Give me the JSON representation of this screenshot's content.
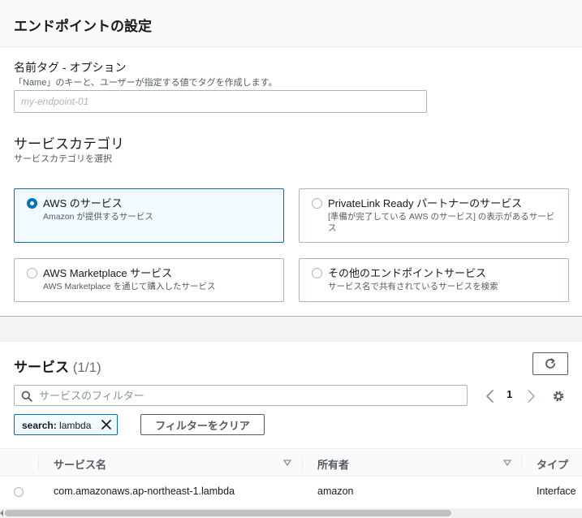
{
  "endpoint_settings": {
    "title": "エンドポイントの設定",
    "name_tag": {
      "label": "名前タグ - オプション",
      "description": "「Name」のキーと、ユーザーが指定する値でタグを作成します。",
      "placeholder": "my-endpoint-01",
      "value": ""
    },
    "service_category": {
      "title": "サービスカテゴリ",
      "description": "サービスカテゴリを選択",
      "selected": "aws",
      "options": [
        {
          "id": "aws",
          "title": "AWS のサービス",
          "description": "Amazon が提供するサービス"
        },
        {
          "id": "privatelink",
          "title": "PrivateLink Ready パートナーのサービス",
          "description": "[準備が完了している AWS のサービス] の表示があるサービス"
        },
        {
          "id": "marketplace",
          "title": "AWS Marketplace サービス",
          "description": "AWS Marketplace を通じて購入したサービス"
        },
        {
          "id": "other",
          "title": "その他のエンドポイントサービス",
          "description": "サービス名で共有されているサービスを検索"
        }
      ]
    }
  },
  "services": {
    "title": "サービス",
    "count": "(1/1)",
    "search_placeholder": "サービスのフィルター",
    "page": "1",
    "filter_token": {
      "key": "search:",
      "value": "lambda"
    },
    "clear_filters_label": "フィルターをクリア",
    "columns": [
      "サービス名",
      "所有者",
      "タイプ"
    ],
    "rows": [
      {
        "service_name": "com.amazonaws.ap-northeast-1.lambda",
        "owner": "amazon",
        "type": "Interface"
      }
    ]
  },
  "colors": {
    "accent": "#0073bb",
    "selected_bg": "#f1faff",
    "border": "#aab7b8"
  },
  "icons": [
    "search-icon",
    "refresh-icon",
    "chevron-left-icon",
    "chevron-right-icon",
    "gear-icon",
    "close-icon",
    "sort-caret-icon"
  ]
}
